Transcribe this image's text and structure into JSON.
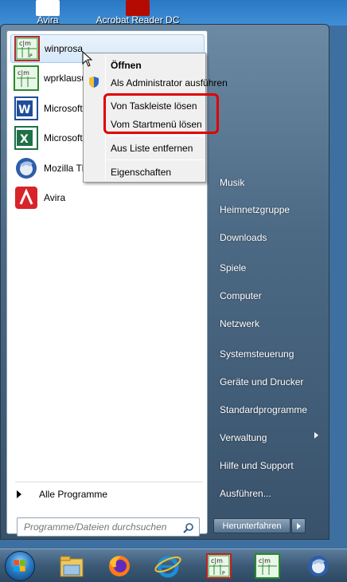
{
  "desktop": {
    "icons": [
      {
        "label": "Avira",
        "icon": "avira-icon"
      },
      {
        "label": "Acrobat Reader DC",
        "icon": "acrobat-icon"
      }
    ]
  },
  "start_menu": {
    "programs": [
      {
        "label": "winprosa",
        "icon": "winprosa-icon",
        "highlighted": true
      },
      {
        "label": "wprklausu",
        "icon": "winprosa-icon"
      },
      {
        "label": "Microsoft",
        "icon": "word-icon"
      },
      {
        "label": "Microsoft",
        "icon": "excel-icon"
      },
      {
        "label": "Mozilla Th",
        "icon": "thunderbird-icon"
      },
      {
        "label": "Avira",
        "icon": "avira-icon"
      }
    ],
    "all_programs": "Alle Programme",
    "search_placeholder": "Programme/Dateien durchsuchen",
    "right_items": [
      {
        "label": "Musik"
      },
      {
        "label": "Heimnetzgruppe"
      },
      {
        "label": "Downloads"
      },
      {
        "label": "Spiele"
      },
      {
        "label": "Computer"
      },
      {
        "label": "Netzwerk"
      },
      {
        "label": "Systemsteuerung"
      },
      {
        "label": "Geräte und Drucker"
      },
      {
        "label": "Standardprogramme"
      },
      {
        "label": "Verwaltung",
        "has_submenu": true
      },
      {
        "label": "Hilfe und Support"
      },
      {
        "label": "Ausführen..."
      }
    ],
    "shutdown_label": "Herunterfahren"
  },
  "context_menu": {
    "items": [
      {
        "label": "Öffnen",
        "bold": true
      },
      {
        "label": "Als Administrator ausführen",
        "icon": "uac-shield-icon"
      },
      {
        "label": "Von Taskleiste lösen",
        "emphasized": true
      },
      {
        "label": "Vom Startmenü lösen",
        "emphasized": true
      },
      {
        "label": "Aus Liste entfernen"
      },
      {
        "label": "Eigenschaften"
      }
    ],
    "emphasis_color": "#e00000"
  },
  "taskbar": {
    "items": [
      {
        "icon": "start-orb-icon"
      },
      {
        "icon": "explorer-icon"
      },
      {
        "icon": "firefox-icon"
      },
      {
        "icon": "internet-explorer-icon"
      },
      {
        "icon": "winprosa-icon"
      },
      {
        "icon": "winprosa-icon"
      },
      {
        "icon": "thunderbird-icon"
      }
    ]
  }
}
